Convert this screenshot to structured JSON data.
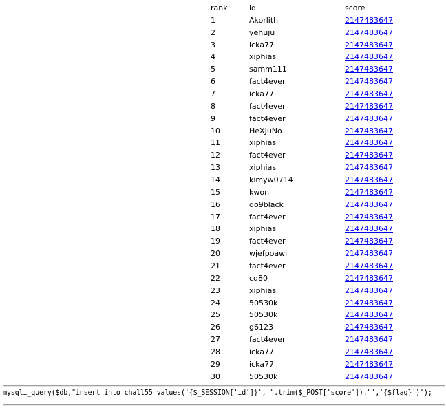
{
  "ranking": {
    "headers": {
      "rank": "rank",
      "id": "id",
      "score": "score"
    },
    "rows": [
      {
        "rank": "1",
        "id": "Akorlith",
        "score": "2147483647"
      },
      {
        "rank": "2",
        "id": "yehuju",
        "score": "2147483647"
      },
      {
        "rank": "3",
        "id": "icka77",
        "score": "2147483647"
      },
      {
        "rank": "4",
        "id": "xiphias",
        "score": "2147483647"
      },
      {
        "rank": "5",
        "id": "samm111",
        "score": "2147483647"
      },
      {
        "rank": "6",
        "id": "fact4ever",
        "score": "2147483647"
      },
      {
        "rank": "7",
        "id": "icka77",
        "score": "2147483647"
      },
      {
        "rank": "8",
        "id": "fact4ever",
        "score": "2147483647"
      },
      {
        "rank": "9",
        "id": "fact4ever",
        "score": "2147483647"
      },
      {
        "rank": "10",
        "id": "HeXJuNo",
        "score": "2147483647"
      },
      {
        "rank": "11",
        "id": "xiphias",
        "score": "2147483647"
      },
      {
        "rank": "12",
        "id": "fact4ever",
        "score": "2147483647"
      },
      {
        "rank": "13",
        "id": "xiphias",
        "score": "2147483647"
      },
      {
        "rank": "14",
        "id": "kimyw0714",
        "score": "2147483647"
      },
      {
        "rank": "15",
        "id": "kwon",
        "score": "2147483647"
      },
      {
        "rank": "16",
        "id": "do9black",
        "score": "2147483647"
      },
      {
        "rank": "17",
        "id": "fact4ever",
        "score": "2147483647"
      },
      {
        "rank": "18",
        "id": "xiphias",
        "score": "2147483647"
      },
      {
        "rank": "19",
        "id": "fact4ever",
        "score": "2147483647"
      },
      {
        "rank": "20",
        "id": "wjefpoawj",
        "score": "2147483647"
      },
      {
        "rank": "21",
        "id": "fact4ever",
        "score": "2147483647"
      },
      {
        "rank": "22",
        "id": "cd80",
        "score": "2147483647"
      },
      {
        "rank": "23",
        "id": "xiphias",
        "score": "2147483647"
      },
      {
        "rank": "24",
        "id": "50530k",
        "score": "2147483647"
      },
      {
        "rank": "25",
        "id": "50530k",
        "score": "2147483647"
      },
      {
        "rank": "26",
        "id": "g6123",
        "score": "2147483647"
      },
      {
        "rank": "27",
        "id": "fact4ever",
        "score": "2147483647"
      },
      {
        "rank": "28",
        "id": "icka77",
        "score": "2147483647"
      },
      {
        "rank": "29",
        "id": "icka77",
        "score": "2147483647"
      },
      {
        "rank": "30",
        "id": "50530k",
        "score": "2147483647"
      }
    ]
  },
  "source_code": "mysqli_query($db,\"insert into chall55 values('{$_SESSION['id']}','\".trim($_POST['score']).\"','{$flag}')\");",
  "colors": {
    "link": "#0000ee",
    "text": "#000000",
    "background": "#ffffff"
  }
}
